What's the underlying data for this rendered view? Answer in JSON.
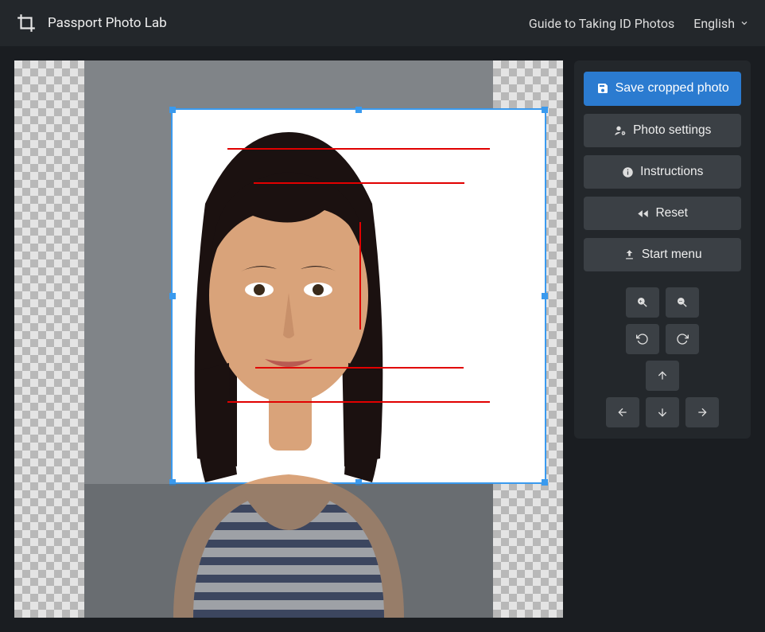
{
  "header": {
    "app_title": "Passport Photo Lab",
    "guide_link": "Guide to Taking ID Photos",
    "language": "English"
  },
  "sidebar": {
    "save_label": "Save cropped photo",
    "photo_settings_label": "Photo settings",
    "instructions_label": "Instructions",
    "reset_label": "Reset",
    "start_menu_label": "Start menu"
  },
  "tools": {
    "zoom_in": "zoom-in",
    "zoom_out": "zoom-out",
    "rotate_ccw": "rotate-ccw",
    "rotate_cw": "rotate-cw",
    "nudge_up": "up",
    "nudge_down": "down",
    "nudge_left": "left",
    "nudge_right": "right"
  },
  "colors": {
    "primary": "#2b7bd0",
    "guide_line": "#e10000",
    "crop_border": "#3a9aee",
    "panel": "#23272b",
    "app_bg": "#1a1d21"
  }
}
